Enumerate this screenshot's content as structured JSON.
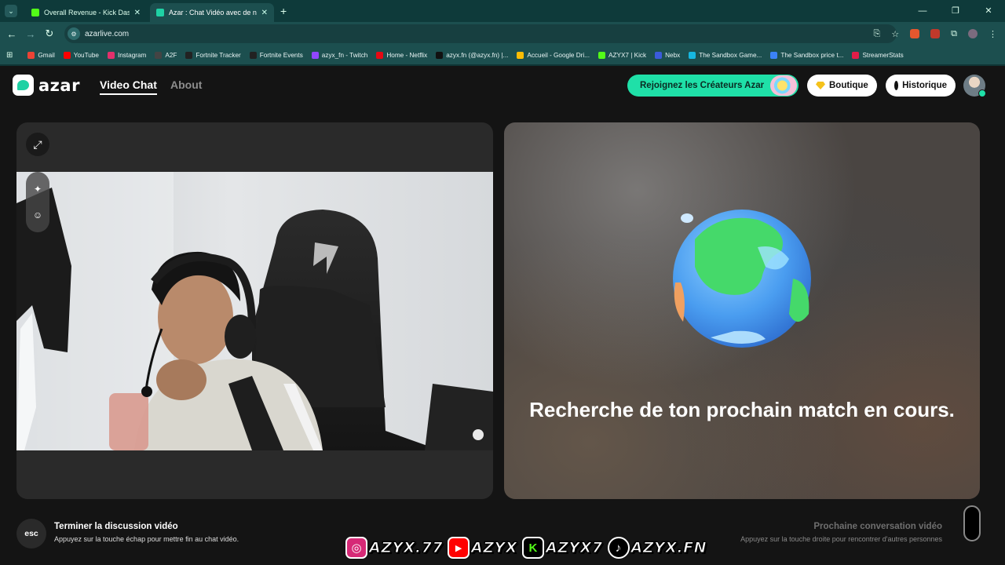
{
  "browser": {
    "tabs": [
      {
        "title": "Overall Revenue - Kick Dashboard",
        "color": "#53fc18"
      },
      {
        "title": "Azar : Chat Vidéo avec de nouv",
        "color": "#1fd1a4"
      }
    ],
    "url": "azarlive.com",
    "bookmarks": [
      {
        "label": "Gmail",
        "color": "#ea4335"
      },
      {
        "label": "YouTube",
        "color": "#ff0000"
      },
      {
        "label": "Instagram",
        "color": "#e1306c"
      },
      {
        "label": "A2F",
        "color": "#444444"
      },
      {
        "label": "Fortnite Tracker",
        "color": "#222222"
      },
      {
        "label": "Fortnite Events",
        "color": "#222222"
      },
      {
        "label": "azyx_fn - Twitch",
        "color": "#9146ff"
      },
      {
        "label": "Home - Netflix",
        "color": "#e50914"
      },
      {
        "label": "azyx.fn (@azyx.fn) |...",
        "color": "#111111"
      },
      {
        "label": "Accueil - Google Dri...",
        "color": "#fbbc04"
      },
      {
        "label": "AZYX7 | Kick",
        "color": "#53fc18"
      },
      {
        "label": "Nebx",
        "color": "#3b5bdb"
      },
      {
        "label": "The Sandbox Game...",
        "color": "#16b7e0"
      },
      {
        "label": "The Sandbox price t...",
        "color": "#3b82f6"
      },
      {
        "label": "StreamerStats",
        "color": "#e11d48"
      }
    ]
  },
  "header": {
    "logo": "azar",
    "nav": {
      "video_chat": "Video Chat",
      "about": "About"
    },
    "creators_button": "Rejoignez les Créateurs Azar",
    "shop_button": "Boutique",
    "history_button": "Historique"
  },
  "main": {
    "status": "Recherche de ton prochain match en cours."
  },
  "footer": {
    "esc_key": "esc",
    "end_title": "Terminer la discussion vidéo",
    "end_subtitle": "Appuyez sur la touche échap pour mettre fin au chat vidéo.",
    "next_title": "Prochaine conversation vidéo",
    "next_subtitle": "Appuyez sur la touche droite pour rencontrer d'autres personnes"
  },
  "socials": [
    {
      "platform": "instagram",
      "handle": "AZYX.77",
      "color": "#d62976"
    },
    {
      "platform": "youtube",
      "handle": "AZYX",
      "color": "#ff0000"
    },
    {
      "platform": "kick",
      "handle": "AZYX7",
      "color": "#53fc18"
    },
    {
      "platform": "tiktok",
      "handle": "AZYX.FN",
      "color": "#000000"
    }
  ],
  "colors": {
    "accent": "#1fe0a8",
    "background": "#141414",
    "browser": "#1c4f4f"
  }
}
